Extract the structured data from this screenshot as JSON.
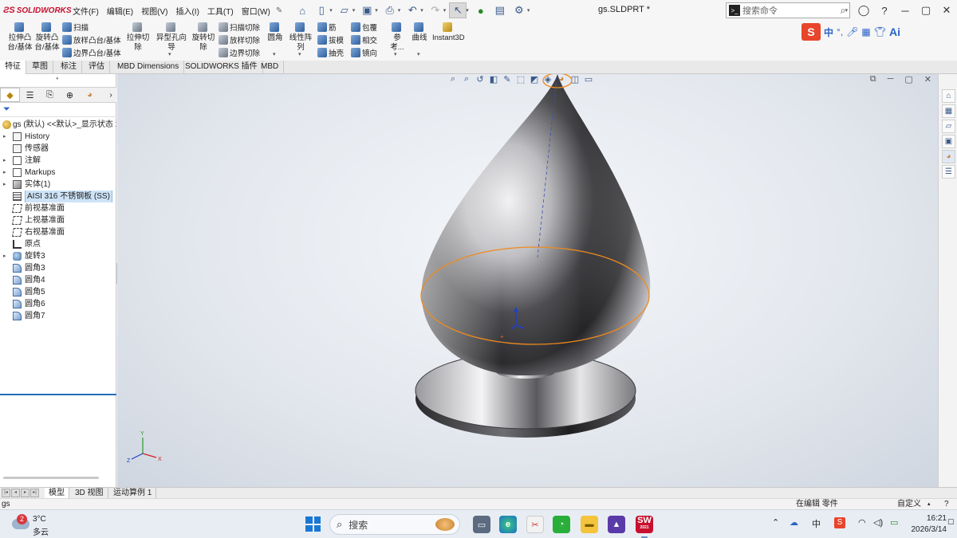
{
  "app": {
    "brand": "SOLIDWORKS",
    "document_title": "gs.SLDPRT *"
  },
  "menu": [
    "文件(F)",
    "编辑(E)",
    "视图(V)",
    "插入(I)",
    "工具(T)",
    "窗口(W)"
  ],
  "search": {
    "placeholder": "搜索命令"
  },
  "ribbon": {
    "extrude_boss": "拉伸凸台/基体",
    "revolve_boss": "旋转凸台/基体",
    "sweep": "扫描",
    "loft_boss": "放样凸台/基体",
    "boundary_boss": "边界凸台/基体",
    "extrude_cut": "拉伸切除",
    "hole_wizard": "异型孔向导",
    "revolve_cut": "旋转切除",
    "sweep_cut": "扫描切除",
    "loft_cut": "放样切除",
    "boundary_cut": "边界切除",
    "fillet": "圆角",
    "linear_pattern": "线性阵列",
    "rib": "筋",
    "draft": "拔模",
    "shell": "抽壳",
    "wrap": "包覆",
    "intersect": "相交",
    "mirror": "镜向",
    "reference": "参考...",
    "curves": "曲线",
    "instant3d": "Instant3D"
  },
  "ime": {
    "logo": "S",
    "lang": "中",
    "ai": "Ai"
  },
  "tabs": [
    "特征",
    "草图",
    "标注",
    "评估",
    "MBD Dimensions",
    "SOLIDWORKS 插件",
    "MBD"
  ],
  "active_tab": "特征",
  "tree": {
    "root": "gs (默认) <<默认>_显示状态 1",
    "items": [
      {
        "label": "History",
        "icon": "folder-icon",
        "arrow": true
      },
      {
        "label": "传感器",
        "icon": "sensor-icon",
        "arrow": false
      },
      {
        "label": "注解",
        "icon": "annotation-icon",
        "arrow": true
      },
      {
        "label": "Markups",
        "icon": "markup-icon",
        "arrow": true
      },
      {
        "label": "实体(1)",
        "icon": "solid-body-icon",
        "arrow": true
      },
      {
        "label": "AISI 316 不锈钢板 (SS)",
        "icon": "material-icon",
        "arrow": false,
        "selected": true
      },
      {
        "label": "前视基准面",
        "icon": "plane-icon",
        "arrow": false
      },
      {
        "label": "上视基准面",
        "icon": "plane-icon",
        "arrow": false
      },
      {
        "label": "右视基准面",
        "icon": "plane-icon",
        "arrow": false
      },
      {
        "label": "原点",
        "icon": "origin-icon",
        "arrow": false
      },
      {
        "label": "旋转3",
        "icon": "revolve-icon",
        "arrow": true
      },
      {
        "label": "圆角3",
        "icon": "fillet-icon",
        "arrow": false
      },
      {
        "label": "圆角4",
        "icon": "fillet-icon",
        "arrow": false
      },
      {
        "label": "圆角5",
        "icon": "fillet-icon",
        "arrow": false
      },
      {
        "label": "圆角6",
        "icon": "fillet-icon",
        "arrow": false
      },
      {
        "label": "圆角7",
        "icon": "fillet-icon",
        "arrow": false
      }
    ]
  },
  "triad": {
    "x": "X",
    "y": "Y",
    "z": "Z"
  },
  "bottom_tabs": [
    "模型",
    "3D 视图",
    "运动算例 1"
  ],
  "status": {
    "left": "gs",
    "mode": "在编辑 零件",
    "units": "自定义"
  },
  "taskbar": {
    "weather_temp": "3°C",
    "weather_cond": "多云",
    "weather_badge": "2",
    "search_placeholder": "搜索",
    "ime_lang": "中",
    "time": "16:21",
    "date": "2026/3/14",
    "sw_label": "SW",
    "sw_year": "2021"
  },
  "colors": {
    "accent": "#1f6fba",
    "selection_edge": "#f08a1e",
    "brand_red": "#c8102e"
  }
}
